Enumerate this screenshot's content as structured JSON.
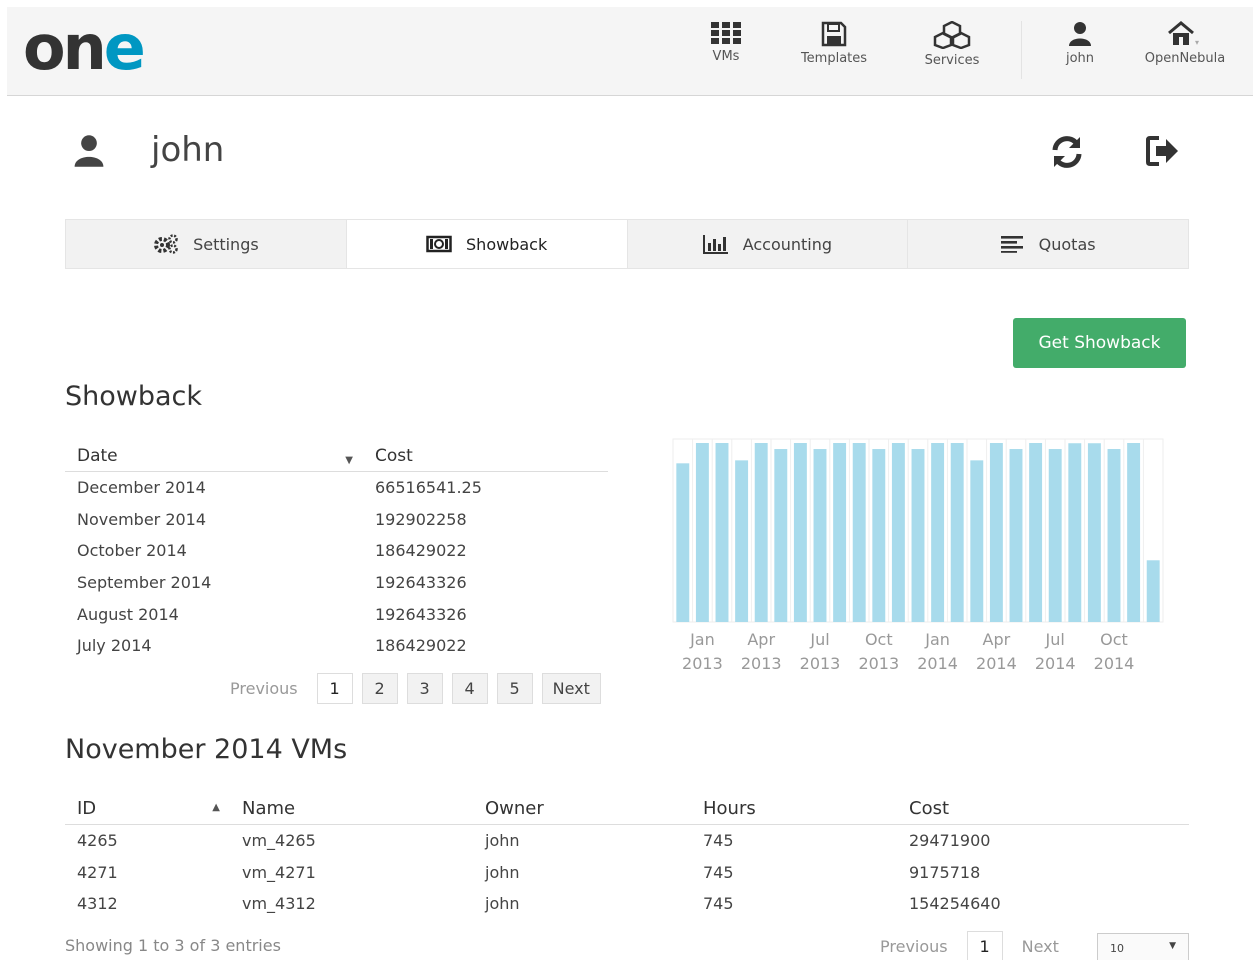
{
  "app": {
    "logo": {
      "o": "o",
      "n": "n",
      "e": "e"
    }
  },
  "nav": [
    {
      "label": "VMs",
      "icon": "grid-icon"
    },
    {
      "label": "Templates",
      "icon": "floppy-icon"
    },
    {
      "label": "Services",
      "icon": "cubes-icon"
    },
    {
      "label": "john",
      "icon": "user-icon"
    },
    {
      "label": "OpenNebula",
      "icon": "home-icon"
    }
  ],
  "header": {
    "username": "john"
  },
  "tabs": [
    {
      "label": "Settings",
      "icon": "cogs-icon",
      "active": false
    },
    {
      "label": "Showback",
      "icon": "money-icon",
      "active": true
    },
    {
      "label": "Accounting",
      "icon": "bar-chart-icon",
      "active": false
    },
    {
      "label": "Quotas",
      "icon": "align-left-icon",
      "active": false
    }
  ],
  "get_showback_label": "Get Showback",
  "showback": {
    "title": "Showback",
    "columns": {
      "date": "Date",
      "cost": "Cost"
    },
    "rows": [
      {
        "date": "December 2014",
        "cost": "66516541.25"
      },
      {
        "date": "November 2014",
        "cost": "192902258"
      },
      {
        "date": "October 2014",
        "cost": "186429022"
      },
      {
        "date": "September 2014",
        "cost": "192643326"
      },
      {
        "date": "August 2014",
        "cost": "192643326"
      },
      {
        "date": "July 2014",
        "cost": "186429022"
      }
    ],
    "pager": {
      "previous": "Previous",
      "pages": [
        "1",
        "2",
        "3",
        "4",
        "5"
      ],
      "next": "Next",
      "current": "1"
    }
  },
  "chart_data": {
    "type": "bar",
    "title": "",
    "xlabel": "",
    "ylabel": "",
    "tick_labels": [
      {
        "month": "Jan",
        "year": "2013"
      },
      {
        "month": "Apr",
        "year": "2013"
      },
      {
        "month": "Jul",
        "year": "2013"
      },
      {
        "month": "Oct",
        "year": "2013"
      },
      {
        "month": "Jan",
        "year": "2014"
      },
      {
        "month": "Apr",
        "year": "2014"
      },
      {
        "month": "Jul",
        "year": "2014"
      },
      {
        "month": "Oct",
        "year": "2014"
      }
    ],
    "tick_month_index": [
      1,
      4,
      7,
      10,
      13,
      16,
      19,
      22
    ],
    "categories": [
      "Dec 2012",
      "Jan 2013",
      "Feb 2013",
      "Mar 2013",
      "Apr 2013",
      "May 2013",
      "Jun 2013",
      "Jul 2013",
      "Aug 2013",
      "Sep 2013",
      "Oct 2013",
      "Nov 2013",
      "Dec 2013",
      "Jan 2014",
      "Feb 2014",
      "Mar 2014",
      "Apr 2014",
      "May 2014",
      "Jun 2014",
      "Jul 2014",
      "Aug 2014",
      "Sep 2014",
      "Oct 2014",
      "Nov 2014",
      "Dec 2014"
    ],
    "values": [
      171000000,
      192900000,
      192900000,
      174200000,
      192900000,
      186400000,
      192900000,
      186400000,
      192900000,
      192900000,
      186400000,
      192900000,
      186400000,
      192900000,
      192900000,
      174200000,
      192900000,
      186400000,
      192900000,
      186400000,
      192643326,
      192643326,
      186429022,
      192902258,
      66516541.25
    ],
    "ylim": [
      0,
      192902258
    ],
    "grid": true,
    "colors": {
      "bar": "#a8dbec",
      "grid": "#eeeeee",
      "tick": "#999999"
    }
  },
  "vms": {
    "title": "November 2014 VMs",
    "columns": {
      "id": "ID",
      "name": "Name",
      "owner": "Owner",
      "hours": "Hours",
      "cost": "Cost"
    },
    "rows": [
      {
        "id": "4265",
        "name": "vm_4265",
        "owner": "john",
        "hours": "745",
        "cost": "29471900"
      },
      {
        "id": "4271",
        "name": "vm_4271",
        "owner": "john",
        "hours": "745",
        "cost": "9175718"
      },
      {
        "id": "4312",
        "name": "vm_4312",
        "owner": "john",
        "hours": "745",
        "cost": "154254640"
      }
    ],
    "showing": "Showing 1 to 3 of 3 entries",
    "pager": {
      "previous": "Previous",
      "current": "1",
      "next": "Next"
    },
    "page_size": "10"
  },
  "colors": {
    "brand": "#0097c2",
    "success": "#43ac6a"
  }
}
